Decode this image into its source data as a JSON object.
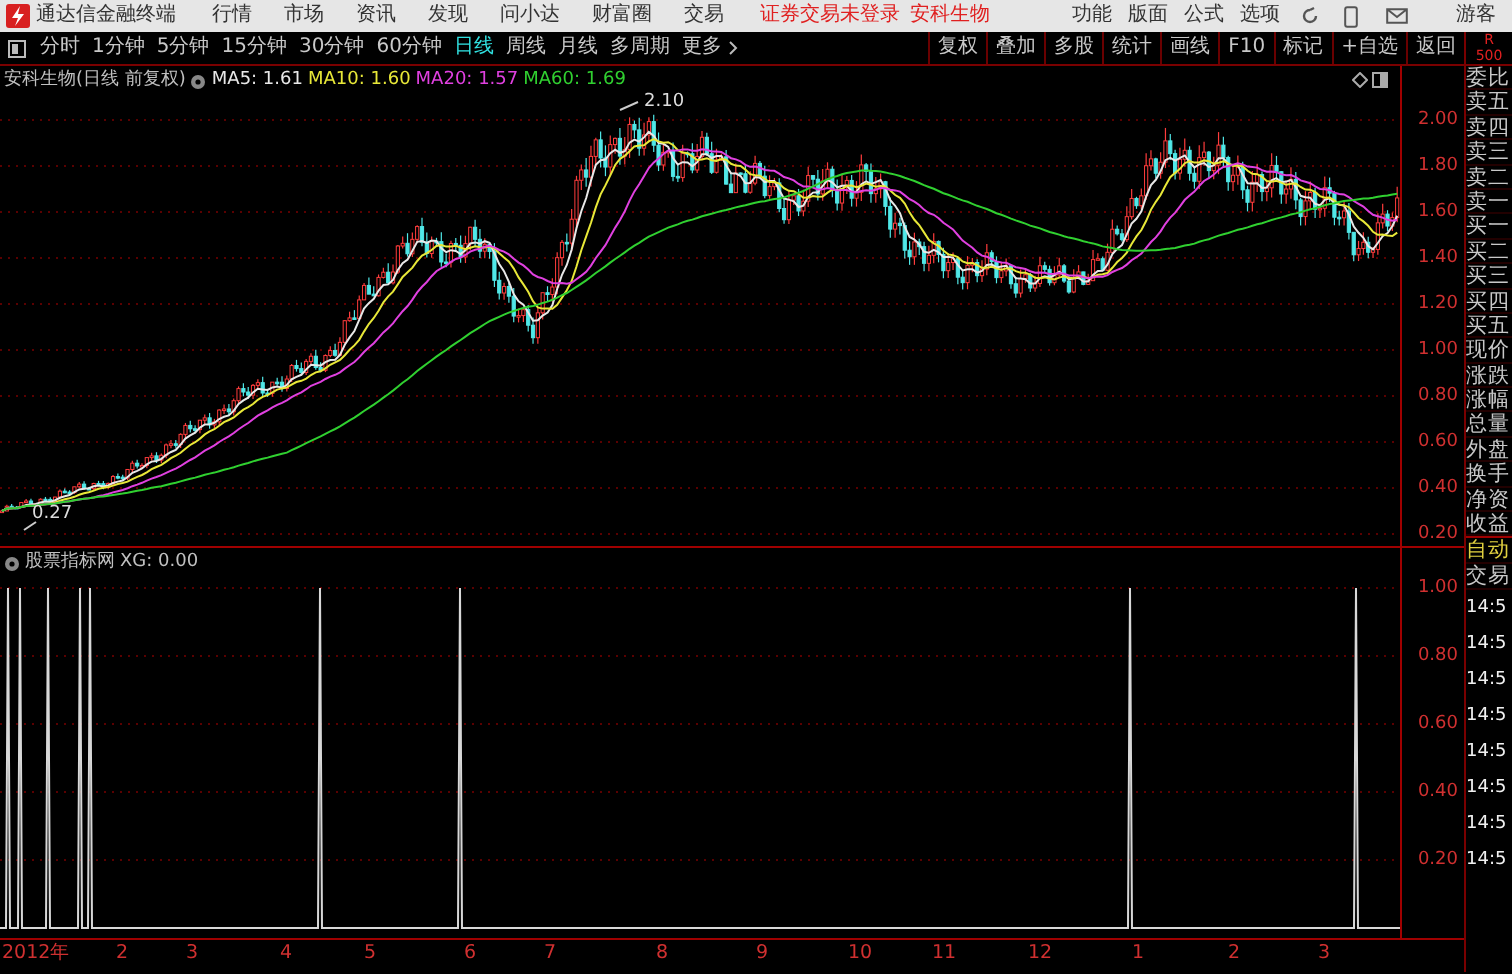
{
  "app": {
    "title": "通达信金融终端",
    "menu": [
      "行情",
      "市场",
      "资讯",
      "发现",
      "问小达",
      "财富圈",
      "交易"
    ],
    "status": [
      "证券交易未登录",
      "安科生物"
    ],
    "right_menu": [
      "功能",
      "版面",
      "公式",
      "选项"
    ],
    "user": "游客"
  },
  "periods": [
    {
      "label": "分时",
      "selected": false
    },
    {
      "label": "1分钟",
      "selected": false
    },
    {
      "label": "5分钟",
      "selected": false
    },
    {
      "label": "15分钟",
      "selected": false
    },
    {
      "label": "30分钟",
      "selected": false
    },
    {
      "label": "60分钟",
      "selected": false
    },
    {
      "label": "日线",
      "selected": true
    },
    {
      "label": "周线",
      "selected": false
    },
    {
      "label": "月线",
      "selected": false
    },
    {
      "label": "多周期",
      "selected": false
    },
    {
      "label": "更多",
      "selected": false
    }
  ],
  "tools": [
    "复权",
    "叠加",
    "多股",
    "统计",
    "画线",
    "F10",
    "标记",
    "+自选",
    "返回"
  ],
  "panel_header": [
    "R",
    "500"
  ],
  "main_chart": {
    "title": "安科生物(日线 前复权)",
    "mas": [
      {
        "label": "MA5: 1.61",
        "color": "#e8e8e8"
      },
      {
        "label": "MA10: 1.60",
        "color": "#e8e838"
      },
      {
        "label": "MA20: 1.57",
        "color": "#e040e0"
      },
      {
        "label": "MA60: 1.69",
        "color": "#30d030"
      }
    ],
    "high_label": "2.10",
    "low_label": "0.27",
    "yticks": [
      "2.00",
      "1.80",
      "1.60",
      "1.40",
      "1.20",
      "1.00",
      "0.80",
      "0.60",
      "0.40",
      "0.20"
    ]
  },
  "indicator": {
    "title": "股票指标网",
    "value": "XG: 0.00",
    "yticks": [
      "1.00",
      "0.80",
      "0.60",
      "0.40",
      "0.20"
    ]
  },
  "xaxis": [
    "2012年",
    "2",
    "3",
    "4",
    "5",
    "6",
    "7",
    "8",
    "9",
    "10",
    "11",
    "12",
    "1",
    "2",
    "3"
  ],
  "quote_labels": [
    "委比",
    "卖五",
    "卖四",
    "卖三",
    "卖二",
    "卖一",
    "买一",
    "买二",
    "买三",
    "买四",
    "买五",
    "现价",
    "涨跌",
    "涨幅",
    "总量",
    "外盘",
    "换手",
    "净资",
    "收益"
  ],
  "trade": {
    "mode": "自动",
    "title": "交易",
    "times": [
      "14:5",
      "14:5",
      "14:5",
      "14:5",
      "14:5",
      "14:5",
      "14:5",
      "14:5"
    ]
  }
}
